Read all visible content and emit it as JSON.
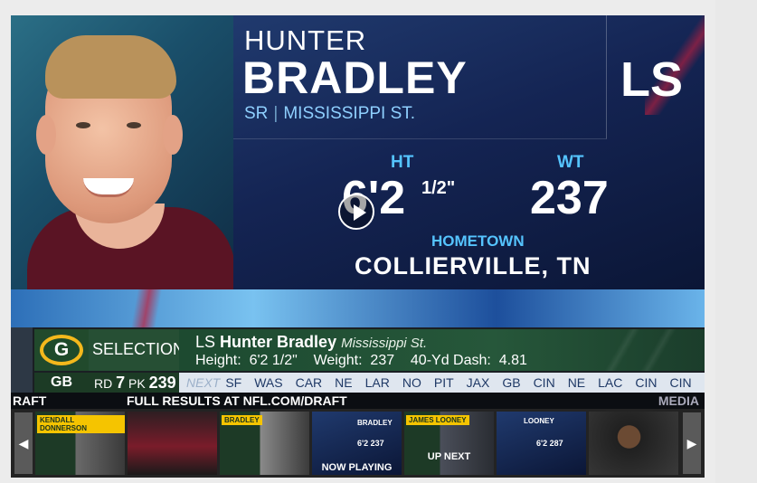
{
  "player": {
    "first_name": "HUNTER",
    "last_name": "BRADLEY",
    "class_year": "SR",
    "college": "MISSISSIPPI ST.",
    "position": "LS",
    "height_label": "HT",
    "height_value": "6'2",
    "height_fraction": "1/2\"",
    "weight_label": "WT",
    "weight_value": "237",
    "hometown_label": "HOMETOWN",
    "hometown": "COLLIERVILLE, TN"
  },
  "ticker": {
    "team_logo_letter": "G",
    "team": "GB",
    "selection_label": "SELECTION",
    "round_label": "RD",
    "round": "7",
    "pick_label": "PK",
    "pick": "239",
    "pick_position": "LS",
    "pick_name": "Hunter Bradley",
    "pick_school": "Mississippi St.",
    "stats_line": "Height:  6'2 1/2\"    Weight:  237    40-Yd Dash:  4.81",
    "next_label": "NEXT",
    "next_teams": [
      "SF",
      "WAS",
      "CAR",
      "NE",
      "LAR",
      "NO",
      "PIT",
      "JAX",
      "GB",
      "CIN",
      "NE",
      "LAC",
      "CIN",
      "CIN"
    ],
    "results_left": "RAFT",
    "results_text": "FULL RESULTS AT NFL.COM/DRAFT",
    "results_right": "MEDIA"
  },
  "carousel": {
    "prev": "◀",
    "next": "▶",
    "items": [
      {
        "label": "",
        "badge": "KENDALL DONNERSON"
      },
      {
        "label": "",
        "badge": ""
      },
      {
        "label": "",
        "badge": "BRADLEY"
      },
      {
        "label": "NOW PLAYING",
        "badge": ""
      },
      {
        "label": "UP NEXT",
        "badge": "JAMES LOONEY"
      },
      {
        "label": "",
        "badge": ""
      },
      {
        "label": "",
        "badge": ""
      }
    ],
    "mini_looney": "LOONEY",
    "mini_looney_stats": "6'2  287",
    "mini_bradley": "BRADLEY",
    "mini_bradley_stats": "6'2  237"
  },
  "colors": {
    "accent_blue": "#55c4ff",
    "team_green": "#214a2c",
    "team_gold": "#f4b81c"
  }
}
